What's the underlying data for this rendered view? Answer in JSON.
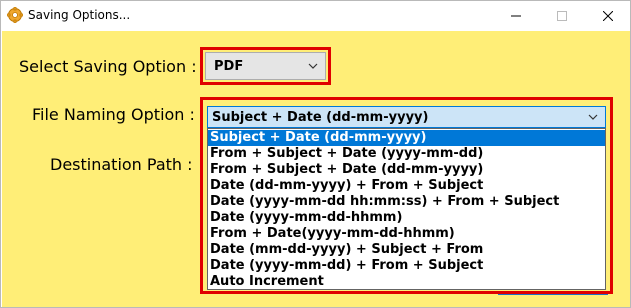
{
  "window": {
    "title": "Saving Options..."
  },
  "icons": {
    "app": "gear-icon",
    "minimize": "minimize-icon",
    "maximize": "maximize-icon",
    "close": "close-icon",
    "dropdown": "chevron-down-icon"
  },
  "colors": {
    "client_bg": "#ffee77",
    "highlight_border": "#e00000",
    "selection": "#0078d7",
    "combo_focus_bg": "#cce4f7"
  },
  "form": {
    "saving_option_label": "Select Saving Option :",
    "saving_option_value": "PDF",
    "file_naming_label": "File Naming Option :",
    "file_naming_value": "Subject + Date (dd-mm-yyyy)",
    "destination_label": "Destination Path :"
  },
  "file_naming_options": [
    "Subject + Date (dd-mm-yyyy)",
    "From + Subject + Date (yyyy-mm-dd)",
    "From + Subject + Date (dd-mm-yyyy)",
    "Date (dd-mm-yyyy) + From + Subject",
    "Date (yyyy-mm-dd hh:mm:ss) + From + Subject",
    "Date (yyyy-mm-dd-hhmm)",
    "From + Date(yyyy-mm-dd-hhmm)",
    "Date (mm-dd-yyyy) + Subject + From",
    "Date (yyyy-mm-dd) + From + Subject",
    "Auto Increment"
  ],
  "selected_option_index": 0
}
